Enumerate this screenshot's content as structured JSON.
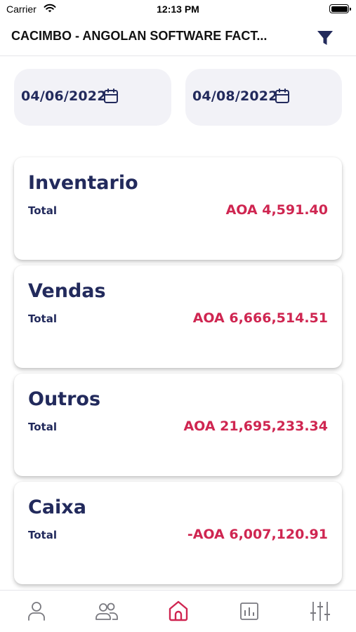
{
  "status_bar": {
    "carrier": "Carrier",
    "time": "12:13 PM"
  },
  "header": {
    "title": "CACIMBO - ANGOLAN SOFTWARE FACT...",
    "filter_icon": "filter-icon"
  },
  "filters": {
    "start_date": "04/06/2022",
    "end_date": "04/08/2022",
    "date_icon": "calendar-icon"
  },
  "cards": [
    {
      "title": "Inventario",
      "total_label": "Total",
      "amount": "AOA 4,591.40"
    },
    {
      "title": "Vendas",
      "total_label": "Total",
      "amount": "AOA 6,666,514.51"
    },
    {
      "title": "Outros",
      "total_label": "Total",
      "amount": "AOA 21,695,233.34"
    },
    {
      "title": "Caixa",
      "total_label": "Total",
      "amount": "-AOA 6,007,120.91"
    }
  ],
  "tab_bar": {
    "items": [
      {
        "icon": "user-icon",
        "active": false
      },
      {
        "icon": "users-icon",
        "active": false
      },
      {
        "icon": "home-icon",
        "active": true
      },
      {
        "icon": "chart-icon",
        "active": false
      },
      {
        "icon": "sliders-icon",
        "active": false
      }
    ]
  },
  "colors": {
    "primary": "#222a5c",
    "accent": "#cf2651",
    "pill_background": "#f2f2f7",
    "inactive_icon": "#7a7a80"
  }
}
